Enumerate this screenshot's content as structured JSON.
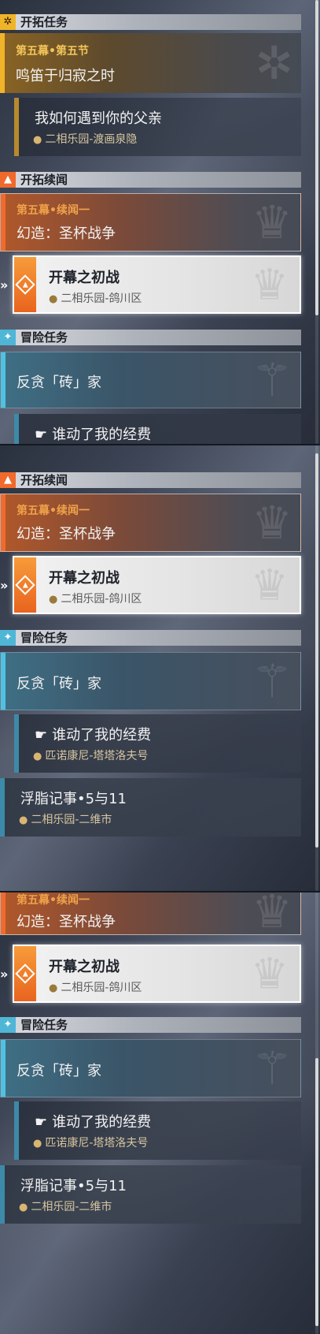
{
  "sections": {
    "trailblaze_mission": "开拓任务",
    "companion_mission": "开拓续闻",
    "adventure_mission": "冒险任务"
  },
  "main_quest": {
    "chapter": "第五幕•第五节",
    "title": "鸣笛于归寂之时",
    "sub_title": "我如何遇到你的父亲",
    "sub_location": "二相乐园-渡画泉隐"
  },
  "companion_quest": {
    "chapter": "第五幕•续闻一",
    "title": "幻造：圣杯战争",
    "tracked_title": "开幕之初战",
    "tracked_location": "二相乐园-鸽川区"
  },
  "adventure_quest": {
    "title": "反贪「砖」家",
    "sub_title": "谁动了我的经费",
    "sub_location": "匹诺康尼-塔塔洛夫号"
  },
  "other_task": {
    "title": "浮脂记事•5与11",
    "location": "二相乐园-二维市"
  },
  "icons": {
    "trailblaze": "sun-emblem-icon",
    "companion": "triangle-emblem-icon",
    "adventure": "star-emblem-icon",
    "location": "location-pin-icon",
    "hand": "hand-icon",
    "track": "track-arrow-icon"
  },
  "colors": {
    "trailblaze_accent": "#f0b429",
    "companion_accent": "#f06a2c",
    "adventure_accent": "#4fc2e4"
  }
}
